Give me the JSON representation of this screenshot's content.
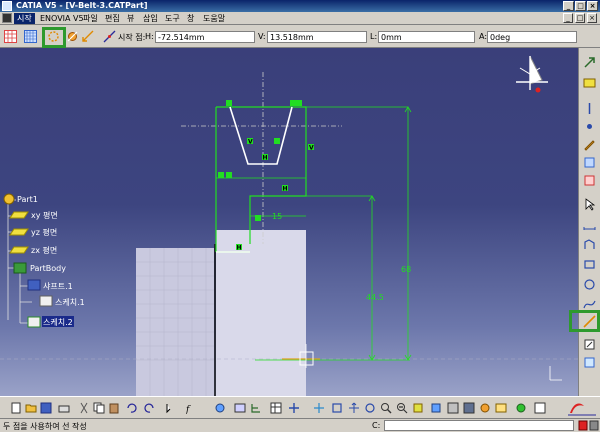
{
  "window": {
    "title": "CATIA V5 - [V-Belt-3.CATPart]"
  },
  "menu": {
    "items": [
      "시작",
      "ENOVIA V5",
      "파일",
      "편집",
      "뷰",
      "삽입",
      "도구",
      "창",
      "도움말"
    ]
  },
  "tools_palette": {
    "start_point_label": "시작 점:",
    "h_label": "H:",
    "h_value": "-72.514mm",
    "v_label": "V:",
    "v_value": "13.518mm",
    "l_label": "L:",
    "l_value": "0mm",
    "a_label": "A:",
    "a_value": "0deg"
  },
  "spec_tree": {
    "root": "Part1",
    "planes": [
      "xy 평면",
      "yz 평면",
      "zx 평면"
    ],
    "body": "PartBody",
    "body_children": [
      "샤프트.1",
      "스케치.1"
    ],
    "active_sketch": "스케치.2"
  },
  "sketch": {
    "dim_horizontal": "15",
    "dim_vertical_inner": "44.5",
    "dim_vertical_outer": "68",
    "constraint_marks": [
      "V",
      "H",
      "V",
      "H",
      "H"
    ]
  },
  "status": {
    "message": "두 점을 사용하여 선 작성",
    "command_label": "C:"
  },
  "colors": {
    "sketch_green": "#22dd22",
    "highlight": "#2e9a2e",
    "viewport_top": "#3a3f7a",
    "viewport_bottom": "#9aa2c8"
  }
}
